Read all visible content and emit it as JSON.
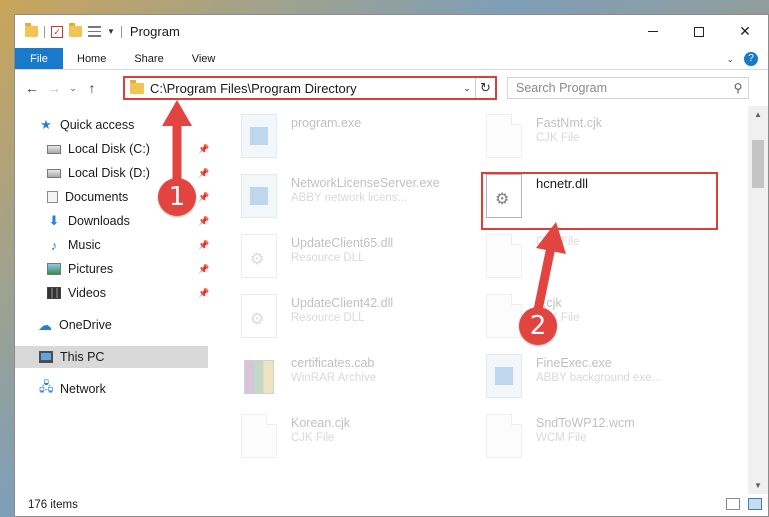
{
  "window": {
    "title": "Program",
    "minimize_label": "",
    "maximize_label": "",
    "close_label": "✕"
  },
  "ribbon": {
    "tabs": [
      "File",
      "Home",
      "Share",
      "View"
    ],
    "help": "?"
  },
  "address": {
    "path": "C:\\Program Files\\Program Directory",
    "search_placeholder": "Search Program"
  },
  "sidebar": {
    "items": [
      {
        "label": "Quick access",
        "icon": "star-icon"
      },
      {
        "label": "Local Disk (C:)",
        "icon": "disk-icon",
        "pinned": true
      },
      {
        "label": "Local Disk (D:)",
        "icon": "disk-icon",
        "pinned": true
      },
      {
        "label": "Documents",
        "icon": "documents-icon",
        "pinned": true
      },
      {
        "label": "Downloads",
        "icon": "download-icon",
        "pinned": true
      },
      {
        "label": "Music",
        "icon": "music-icon",
        "pinned": true
      },
      {
        "label": "Pictures",
        "icon": "pictures-icon",
        "pinned": true
      },
      {
        "label": "Videos",
        "icon": "videos-icon",
        "pinned": true
      },
      {
        "label": "OneDrive",
        "icon": "cloud-icon"
      },
      {
        "label": "This PC",
        "icon": "computer-icon",
        "selected": true
      },
      {
        "label": "Network",
        "icon": "network-icon"
      }
    ]
  },
  "files": [
    {
      "name": "program.exe",
      "desc": "",
      "icon": "program-icon"
    },
    {
      "name": "FastNmt.cjk",
      "desc": "CJK File",
      "icon": "document-icon"
    },
    {
      "name": "NetworkLicenseServer.exe",
      "desc": "ABBY network licens...",
      "icon": "exe-icon"
    },
    {
      "name": "hcnetr.dll",
      "desc": "",
      "icon": "gear-document-icon"
    },
    {
      "name": "UpdateClient65.dll",
      "desc": "Resource DLL",
      "icon": "gear-document-icon"
    },
    {
      "name": "",
      "desc": "CJK File",
      "icon": "document-icon"
    },
    {
      "name": "UpdateClient42.dll",
      "desc": "Resource DLL",
      "icon": "gear-document-icon"
    },
    {
      "name": "...cjk",
      "desc": "CJK File",
      "icon": "document-icon"
    },
    {
      "name": "certificates.cab",
      "desc": "WinRAR Archive",
      "icon": "archive-icon"
    },
    {
      "name": "FineExec.exe",
      "desc": "ABBY background exe...",
      "icon": "exe-icon"
    },
    {
      "name": "Korean.cjk",
      "desc": "CJK File",
      "icon": "document-icon"
    },
    {
      "name": "SndToWP12.wcm",
      "desc": "WCM File",
      "icon": "document-icon"
    }
  ],
  "status": {
    "item_count": "176 items"
  },
  "annotations": {
    "step1": "1",
    "step2": "2"
  },
  "colors": {
    "accent": "#1979ca",
    "highlight": "#d9403a",
    "badge": "#e2443f"
  }
}
